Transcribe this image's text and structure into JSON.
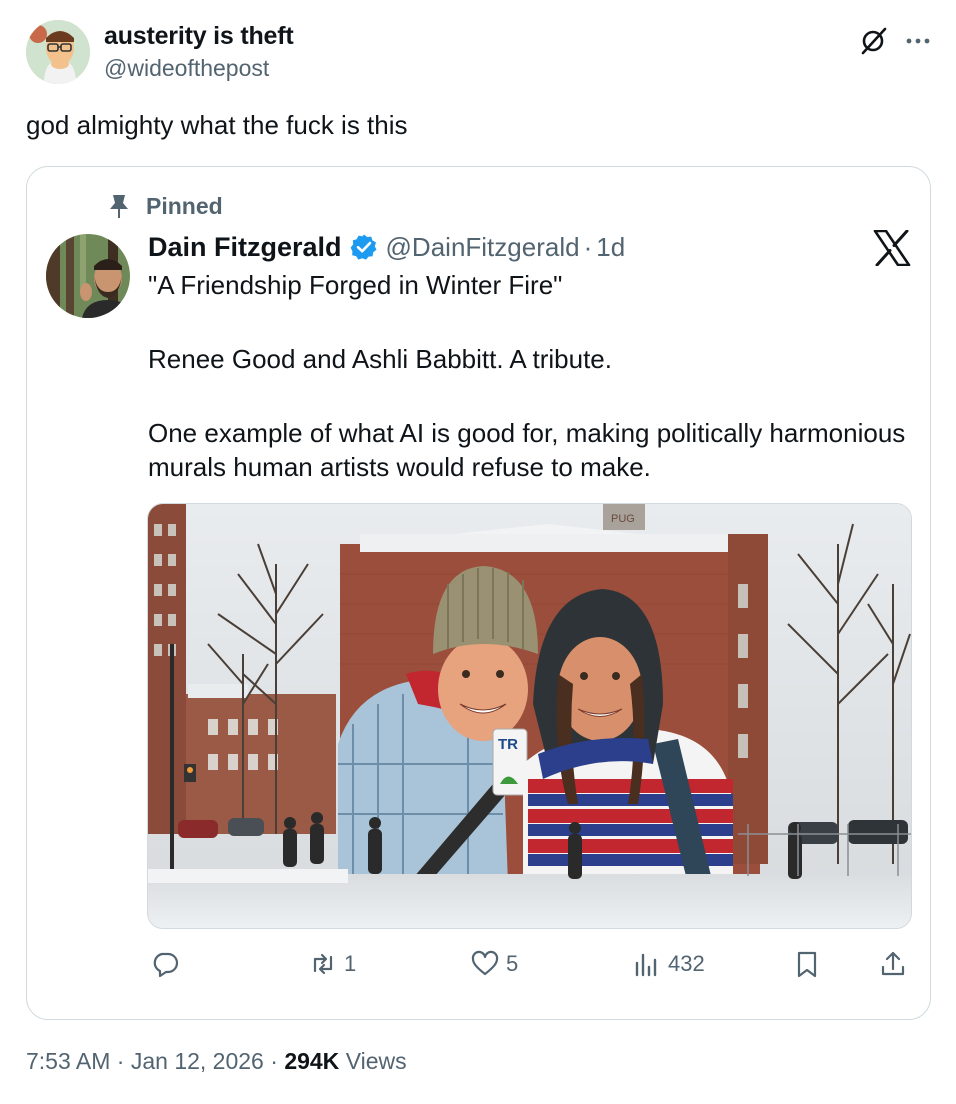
{
  "tweet": {
    "author_name": "austerity is theft",
    "author_handle": "@wideofthepost",
    "text": "god almighty what the fuck is this",
    "time": "7:53 AM",
    "date": "Jan 12, 2026",
    "views_count": "294K",
    "views_label": "Views"
  },
  "quoted": {
    "pinned_label": "Pinned",
    "author_name": "Dain Fitzgerald",
    "author_handle": "@DainFitzgerald",
    "separator": "·",
    "time": "1d",
    "line1": "\"A Friendship Forged in Winter Fire\"",
    "line2": "Renee Good and Ashli Babbitt. A tribute.",
    "line3": "One example of what AI is good for, making politically harmonious murals human artists would refuse to make.",
    "mural_sign": "TR",
    "roof_sign": "PUG",
    "actions": {
      "reposts": "1",
      "likes": "5",
      "views": "432"
    }
  },
  "icons": {
    "grok": "grok-icon",
    "more": "more-options-icon",
    "pin": "pin-icon",
    "verified": "verified-badge-icon",
    "x_logo": "x-logo-icon",
    "reply": "reply-icon",
    "repost": "repost-icon",
    "like": "heart-icon",
    "views": "views-chart-icon",
    "bookmark": "bookmark-icon",
    "share": "share-icon"
  },
  "colors": {
    "text": "#0f1419",
    "secondary": "#536471",
    "verified": "#1d9bf0",
    "border": "#cfd9de"
  }
}
